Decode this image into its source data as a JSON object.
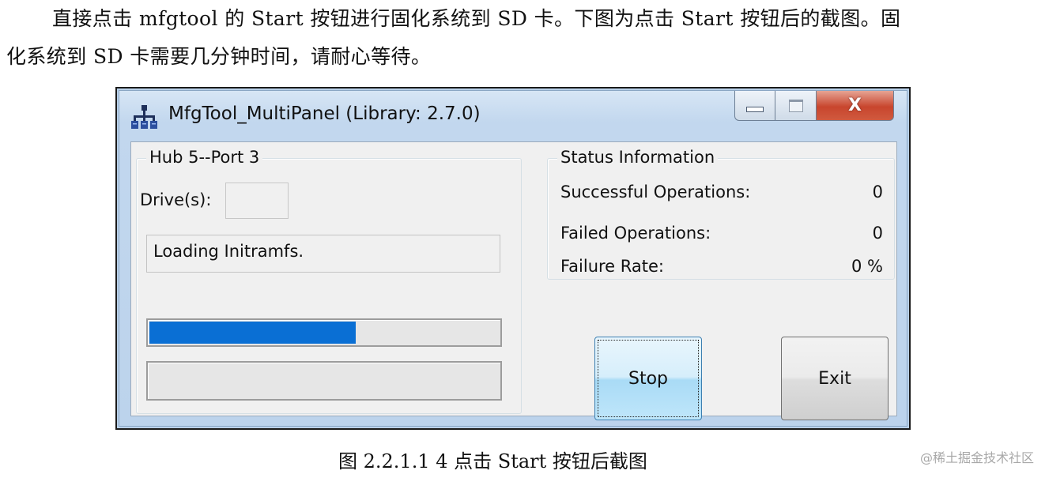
{
  "document": {
    "paragraph_line1": "直接点击 mfgtool 的 Start 按钮进行固化系统到 SD 卡。下图为点击 Start 按钮后的截图。固",
    "paragraph_line2": "化系统到 SD 卡需要几分钟时间，请耐心等待。",
    "caption": "图 2.2.1.1 4  点击 Start 按钮后截图",
    "watermark": "@稀土掘金技术社区"
  },
  "window": {
    "title": "MfgTool_MultiPanel (Library: 2.7.0)",
    "close_glyph": "X",
    "hub_panel": {
      "legend": "Hub 5--Port 3",
      "drives_label": "Drive(s):",
      "drives_value": "",
      "status_text": "Loading Initramfs.",
      "progress_fraction": 0.59,
      "secondary_progress_fraction": 0
    },
    "status_panel": {
      "legend": "Status Information",
      "rows": [
        {
          "label": "Successful Operations:",
          "value": "0"
        },
        {
          "label": "Failed Operations:",
          "value": "0"
        },
        {
          "label": "Failure Rate:",
          "value": "0 %"
        }
      ]
    },
    "buttons": {
      "stop_label": "Stop",
      "exit_label": "Exit"
    }
  },
  "colors": {
    "progress_fill": "#0a6fd4",
    "close_button": "#c8452d",
    "title_bar": "#c2d7ee"
  }
}
